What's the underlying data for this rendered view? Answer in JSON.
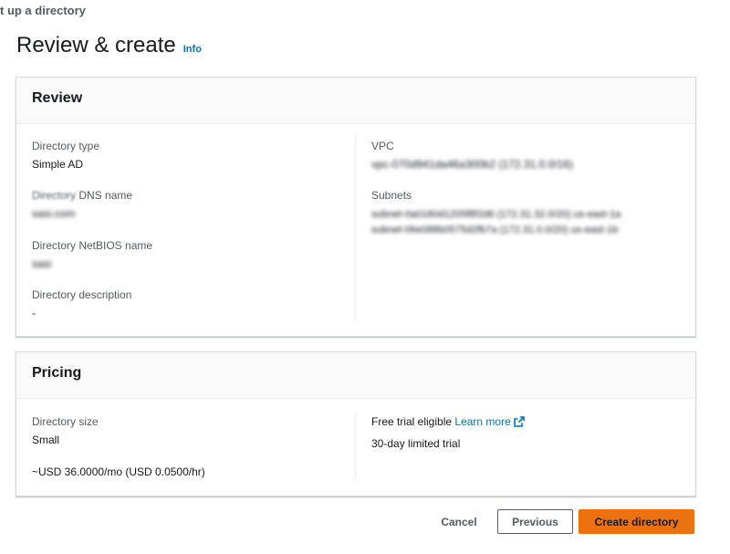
{
  "breadcrumb": "t up a directory",
  "page": {
    "title": "Review & create",
    "info_label": "Info"
  },
  "review": {
    "title": "Review",
    "directory_type_label": "Directory type",
    "directory_type_value": "Simple AD",
    "dns_name_label_prefix": "Directory",
    "dns_name_label_suffix": " DNS name",
    "dns_name_value": "sasi.com",
    "netbios_label": "Directory NetBIOS name",
    "netbios_value": "sasi",
    "description_label": "Directory description",
    "description_value": "-",
    "vpc_label": "VPC",
    "vpc_value": "vpc-070d941da46a300b2 (172.31.0.0/16)",
    "subnets_label": "Subnets",
    "subnets": [
      "subnet-0a0180d1205f8f2d6 (172.31.32.0/20) us-east-1a",
      "subnet-06e088b0575d2fb7a (172.31.0.0/20) us-east-1b"
    ]
  },
  "pricing": {
    "title": "Pricing",
    "size_label": "Directory size",
    "size_value": "Small",
    "price": "~USD 36.0000/mo (USD 0.0500/hr)",
    "free_trial_text": "Free trial eligible",
    "learn_more": "Learn more",
    "trial_note": "30-day limited trial"
  },
  "actions": {
    "cancel": "Cancel",
    "previous": "Previous",
    "create": "Create directory"
  },
  "colors": {
    "primary": "#ec7211",
    "link": "#0073bb",
    "text": "#16191f",
    "muted": "#545b64"
  }
}
